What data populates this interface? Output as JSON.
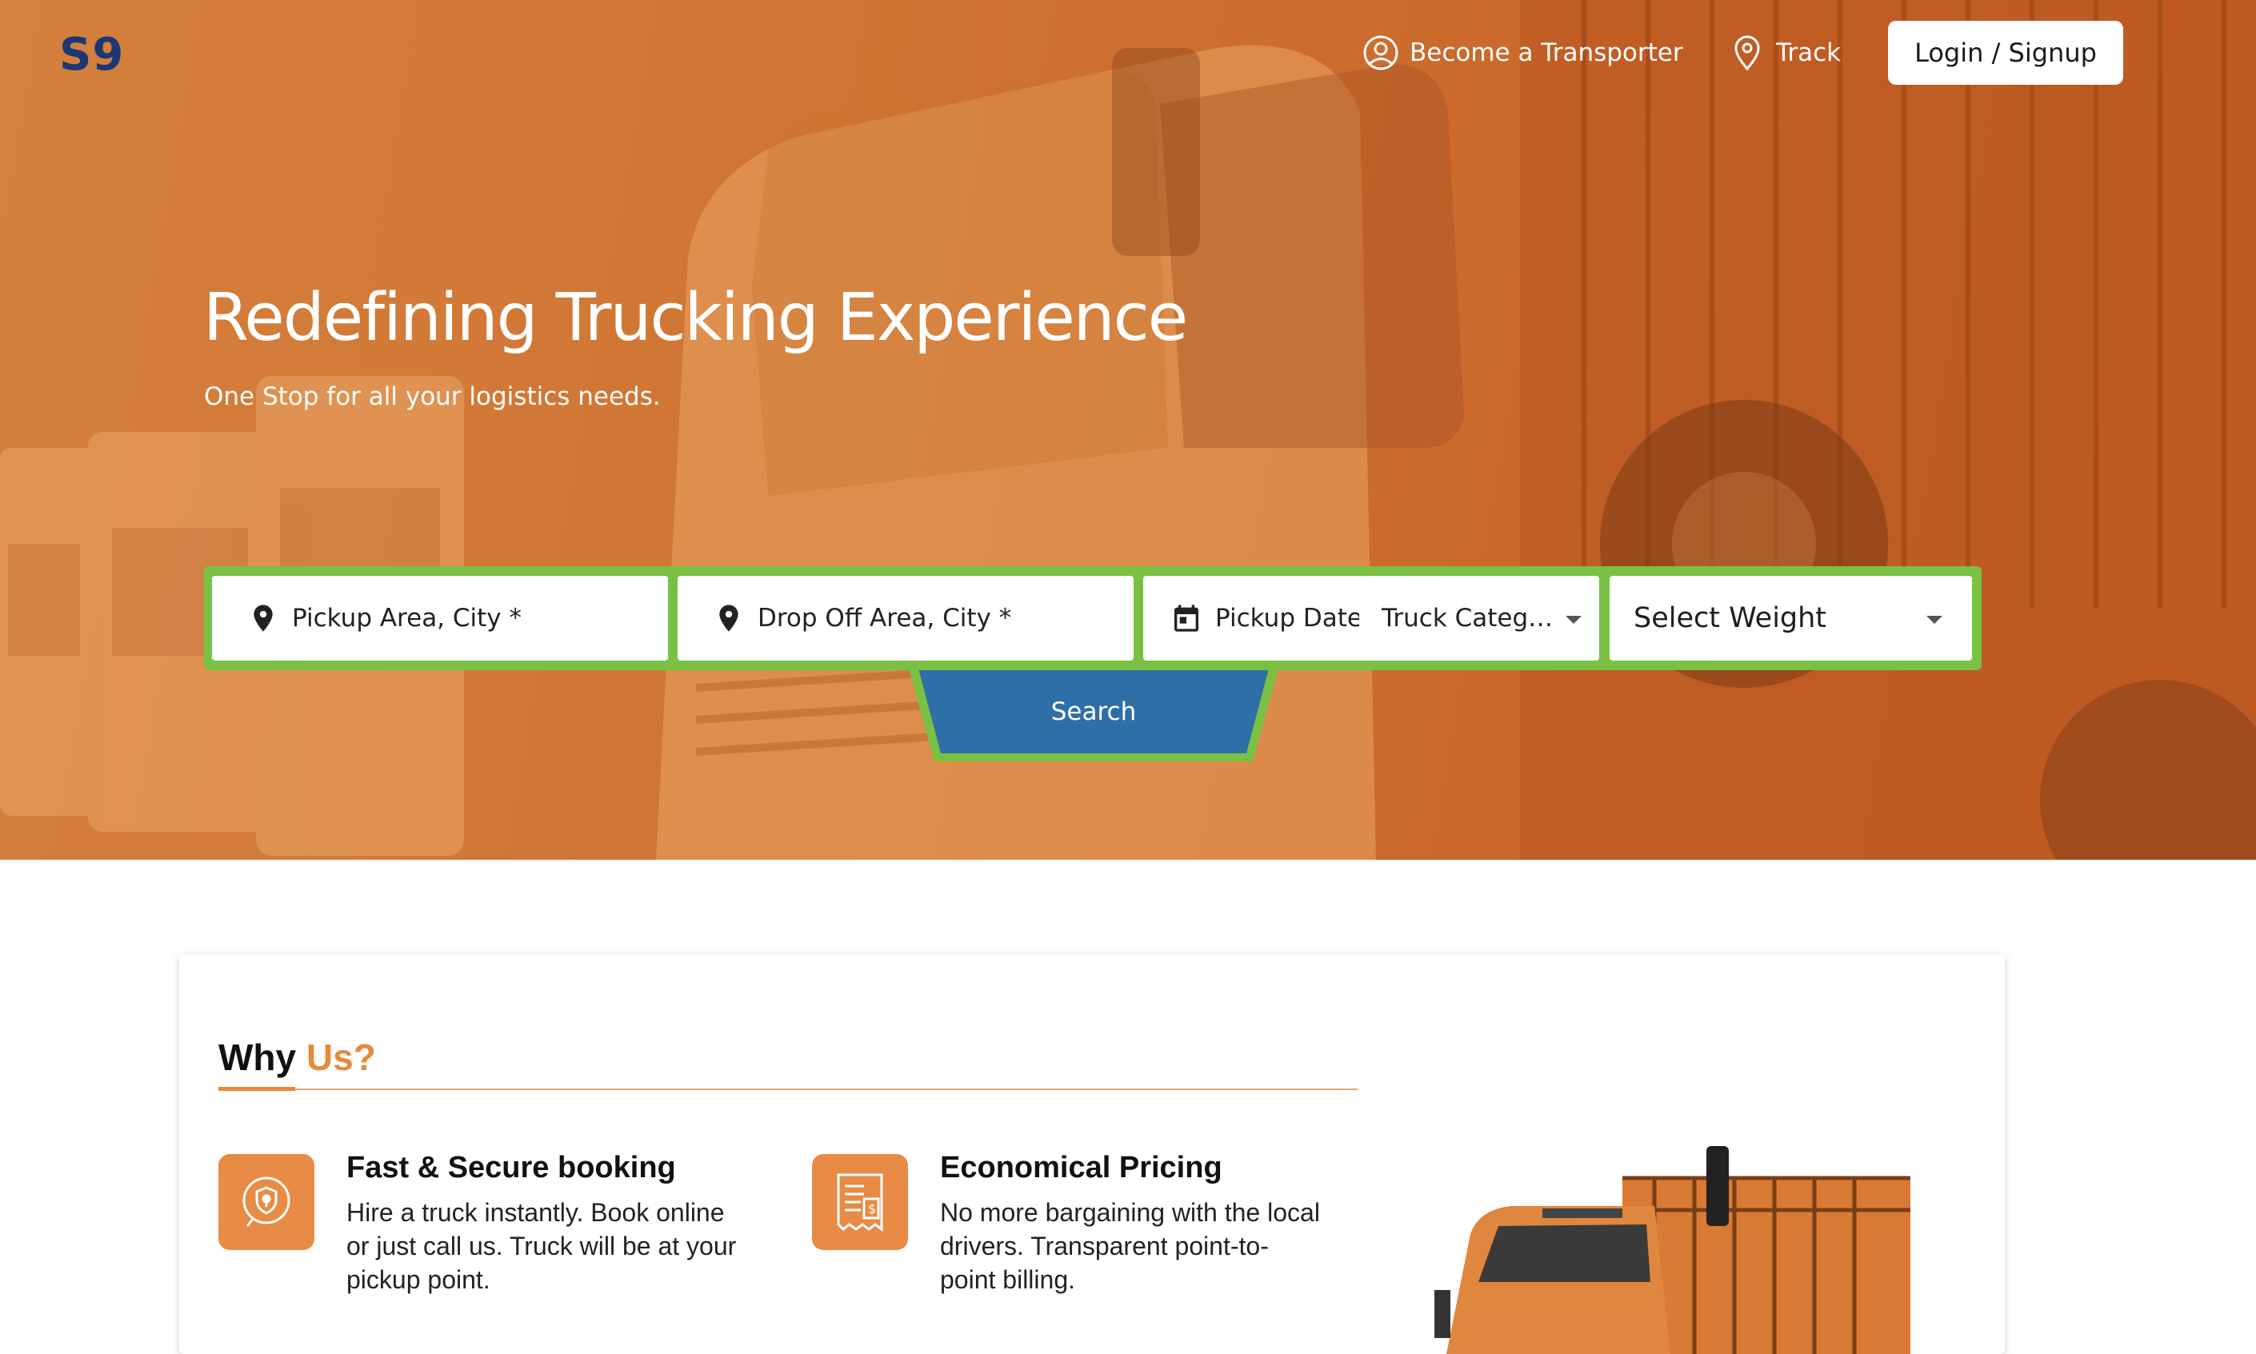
{
  "brand": {
    "logo_text": "S9",
    "logo_color": "#1b3775",
    "accent": "#e58a3c",
    "highlight": "#7ac143",
    "button_blue": "#2f6fa8"
  },
  "nav": {
    "transporter_label": "Become a Transporter",
    "transporter_icon": "user-circle-icon",
    "track_label": "Track",
    "track_icon": "location-pin-icon",
    "login_label": "Login / Signup"
  },
  "hero": {
    "headline": "Redefining Trucking Experience",
    "subline": "One Stop for all your logistics needs."
  },
  "search": {
    "pickup_placeholder": "Pickup Area, City *",
    "dropoff_placeholder": "Drop Off Area, City *",
    "date_placeholder": "Pickup Date",
    "category_placeholder": "Truck Categ…",
    "weight_placeholder": "Select Weight",
    "search_label": "Search"
  },
  "why_us": {
    "title_prefix": "Why",
    "title_accent": "Us?",
    "features": [
      {
        "icon": "shield-touch-icon",
        "title": "Fast & Secure booking",
        "text": "Hire a truck instantly. Book online or just call us. Truck will be at your pickup point."
      },
      {
        "icon": "invoice-dollar-icon",
        "title": "Economical Pricing",
        "text": "No more bargaining with the local drivers. Transparent point-to-point billing."
      }
    ]
  }
}
